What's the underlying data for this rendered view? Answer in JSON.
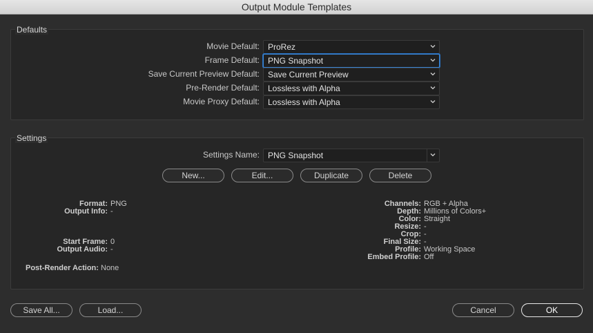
{
  "window": {
    "title": "Output Module Templates"
  },
  "defaults": {
    "title": "Defaults",
    "rows": [
      {
        "label": "Movie Default:",
        "value": "ProRez"
      },
      {
        "label": "Frame Default:",
        "value": "PNG Snapshot"
      },
      {
        "label": "Save Current Preview Default:",
        "value": "Save Current Preview"
      },
      {
        "label": "Pre-Render Default:",
        "value": "Lossless with Alpha"
      },
      {
        "label": "Movie Proxy Default:",
        "value": "Lossless with Alpha"
      }
    ]
  },
  "settings": {
    "title": "Settings",
    "name_label": "Settings Name:",
    "name_value": "PNG Snapshot",
    "buttons": {
      "new": "New...",
      "edit": "Edit...",
      "duplicate": "Duplicate",
      "delete": "Delete"
    },
    "left_info": {
      "format_k": "Format:",
      "format_v": "PNG",
      "output_info_k": "Output Info:",
      "output_info_v": "-",
      "start_frame_k": "Start Frame:",
      "start_frame_v": "0",
      "output_audio_k": "Output Audio:",
      "output_audio_v": "-",
      "post_render_k": "Post-Render Action:",
      "post_render_v": "None"
    },
    "right_info": {
      "channels_k": "Channels:",
      "channels_v": "RGB + Alpha",
      "depth_k": "Depth:",
      "depth_v": "Millions of Colors+",
      "color_k": "Color:",
      "color_v": "Straight",
      "resize_k": "Resize:",
      "resize_v": "-",
      "crop_k": "Crop:",
      "crop_v": "-",
      "final_size_k": "Final Size:",
      "final_size_v": "-",
      "profile_k": "Profile:",
      "profile_v": "Working Space",
      "embed_profile_k": "Embed Profile:",
      "embed_profile_v": "Off"
    }
  },
  "footer": {
    "save_all": "Save All...",
    "load": "Load...",
    "cancel": "Cancel",
    "ok": "OK"
  },
  "icons": {
    "dropdown": "chevron-down-icon"
  },
  "colors": {
    "focus": "#3a86d6",
    "background": "#262626"
  }
}
